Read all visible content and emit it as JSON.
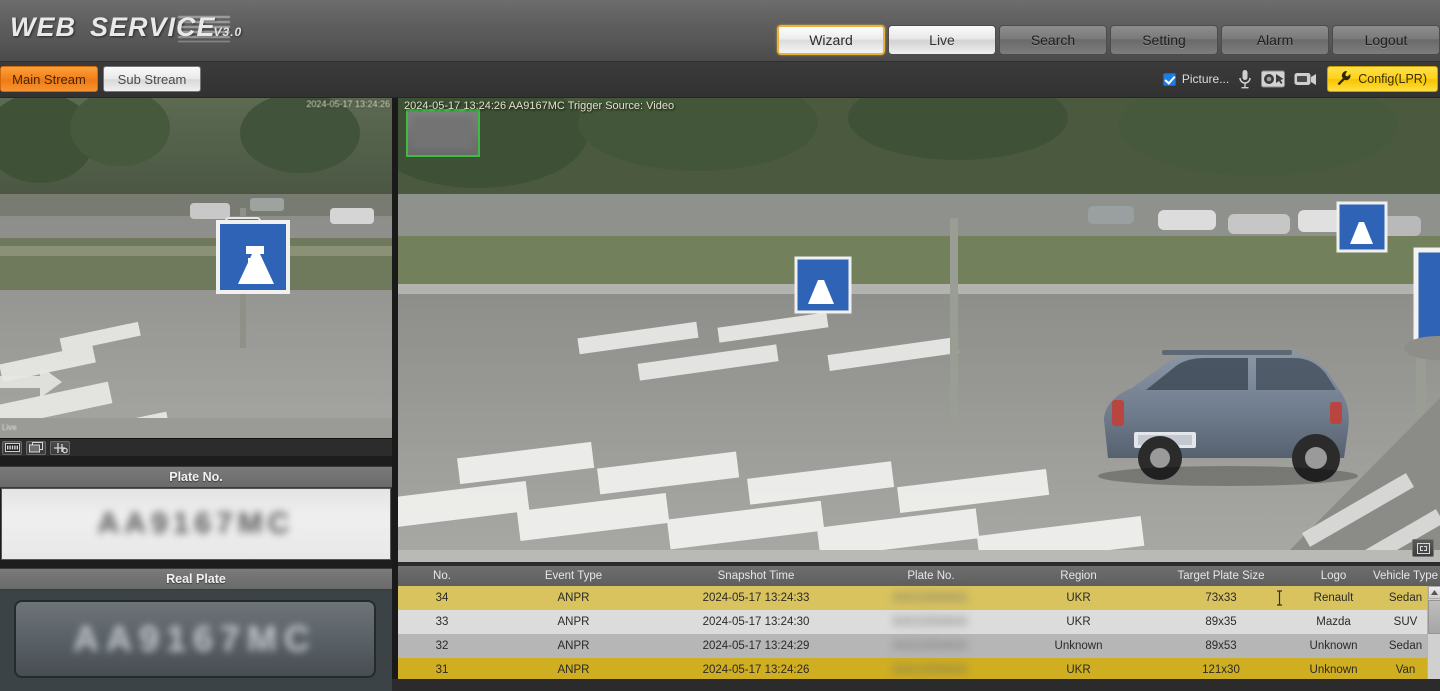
{
  "header": {
    "logo_web": "WEB",
    "logo_service": "SERVICE",
    "logo_version": "V3.0",
    "nav": [
      {
        "label": "Wizard",
        "state": "active"
      },
      {
        "label": "Live",
        "state": "light"
      },
      {
        "label": "Search",
        "state": "normal"
      },
      {
        "label": "Setting",
        "state": "normal"
      },
      {
        "label": "Alarm",
        "state": "normal"
      },
      {
        "label": "Logout",
        "state": "normal"
      }
    ]
  },
  "toolbar": {
    "main_stream_label": "Main Stream",
    "sub_stream_label": "Sub Stream",
    "picture_checkbox_label": "Picture...",
    "picture_checkbox_checked": true,
    "icons": [
      "microphone-icon",
      "snapshot-icon",
      "record-video-icon"
    ],
    "config_button_label": "Config(LPR)",
    "config_button_color": "#ffd21a",
    "active_stream": "Main Stream"
  },
  "left_panel": {
    "preview_timestamp": "2024-05-17 13:24:26",
    "preview_badge": "Live",
    "mini_icons": [
      "plate-display-icon",
      "multi-window-icon",
      "adjust-crosshair-icon"
    ],
    "plate_section_title": "Plate No.",
    "plate_value": "AA9167MC",
    "real_plate_section_title": "Real Plate",
    "real_plate_value": "AA9167MC"
  },
  "main_video": {
    "osd_text": "2024-05-17 13:24:26  AA9167MC  Trigger Source: Video",
    "plate_thumbnail_border_color": "#3dbb45",
    "fullscreen_icon": "fullscreen-icon"
  },
  "table": {
    "columns": [
      "No.",
      "Event Type",
      "Snapshot Time",
      "Plate No.",
      "Region",
      "Target Plate Size",
      "Logo",
      "Vehicle Type"
    ],
    "rows": [
      {
        "no": "34",
        "event_type": "ANPR",
        "snapshot_time": "2024-05-17 13:24:33",
        "plate_no": "AA1234AA",
        "region": "UKR",
        "target_plate_size": "73x33",
        "logo": "Renault",
        "vehicle_type": "Sedan",
        "highlight": "gold-light"
      },
      {
        "no": "33",
        "event_type": "ANPR",
        "snapshot_time": "2024-05-17 13:24:30",
        "plate_no": "AA1234AA",
        "region": "UKR",
        "target_plate_size": "89x35",
        "logo": "Mazda",
        "vehicle_type": "SUV",
        "highlight": "gray-light"
      },
      {
        "no": "32",
        "event_type": "ANPR",
        "snapshot_time": "2024-05-17 13:24:29",
        "plate_no": "AA1234AA",
        "region": "Unknown",
        "target_plate_size": "89x53",
        "logo": "Unknown",
        "vehicle_type": "Sedan",
        "highlight": "gray-dark"
      },
      {
        "no": "31",
        "event_type": "ANPR",
        "snapshot_time": "2024-05-17 13:24:26",
        "plate_no": "AA1234AA",
        "region": "UKR",
        "target_plate_size": "121x30",
        "logo": "Unknown",
        "vehicle_type": "Van",
        "highlight": "gold-dark"
      }
    ],
    "row_colors": {
      "gold-light": "#d8c35f",
      "gold-dark": "#cfae22",
      "gray-light": "#dcdcdc",
      "gray-dark": "#b6b6b6"
    }
  }
}
